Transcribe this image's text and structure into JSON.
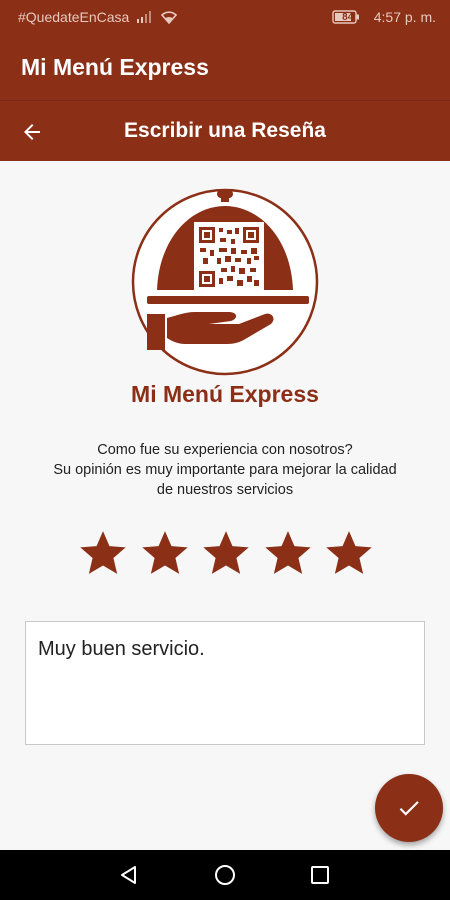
{
  "status_bar": {
    "carrier": "#QuedateEnCasa",
    "battery_level": "84",
    "time": "4:57 p. m.",
    "icons": [
      "signal-icon",
      "wifi-icon",
      "battery-icon"
    ]
  },
  "app_bar": {
    "title": "Mi Menú Express"
  },
  "toolbar": {
    "title": "Escribir una Reseña",
    "back_icon": "arrow-back-icon"
  },
  "logo": {
    "icon": "cloche-qr-logo"
  },
  "brand": {
    "name": "Mi Menú Express"
  },
  "prompt": {
    "line1": "Como fue su experiencia con nosotros?",
    "line2": "Su opinión es muy importante para mejorar la calidad",
    "line3": "de nuestros servicios"
  },
  "rating": {
    "value": 5,
    "max": 5
  },
  "review": {
    "text": "Muy buen servicio."
  },
  "fab": {
    "icon": "check-icon"
  },
  "nav_bar": {
    "icons": [
      "back-triangle-icon",
      "home-circle-icon",
      "recents-square-icon"
    ]
  },
  "colors": {
    "primary": "#8b2f17",
    "background": "#f7f7f7"
  }
}
